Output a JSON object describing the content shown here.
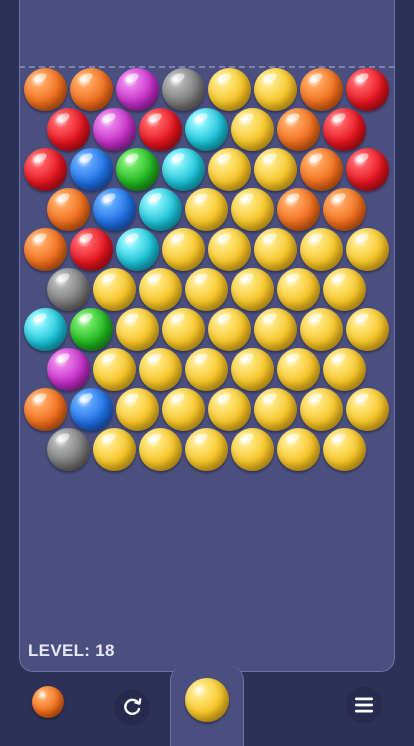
{
  "level_label": "LEVEL: 18",
  "colors": {
    "orange": {
      "base": "#ee6d1c",
      "light": "#ffa35a",
      "dark": "#b84a0a"
    },
    "red": {
      "base": "#e2141f",
      "light": "#ff5a5f",
      "dark": "#a3080f"
    },
    "magenta": {
      "base": "#c12fc4",
      "light": "#e97ae8",
      "dark": "#84138a"
    },
    "gray": {
      "base": "#7a7a7a",
      "light": "#b0b0b0",
      "dark": "#4e4e4e"
    },
    "yellow": {
      "base": "#f6c526",
      "light": "#ffe57a",
      "dark": "#d39a0c"
    },
    "blue": {
      "base": "#1e6fe0",
      "light": "#5ea6ff",
      "dark": "#0f4aa6"
    },
    "green": {
      "base": "#21b51f",
      "light": "#6ee865",
      "dark": "#0f7c12"
    },
    "cyan": {
      "base": "#1cc2d6",
      "light": "#7ef0fa",
      "dark": "#0b8ca0"
    }
  },
  "grid_rows": [
    [
      "orange",
      "orange",
      "magenta",
      "gray",
      "yellow",
      "yellow",
      "orange",
      "red"
    ],
    [
      "red",
      "magenta",
      "red",
      "cyan",
      "yellow",
      "orange",
      "red"
    ],
    [
      "red",
      "blue",
      "green",
      "cyan",
      "yellow",
      "yellow",
      "orange",
      "red"
    ],
    [
      "orange",
      "blue",
      "cyan",
      "yellow",
      "yellow",
      "orange",
      "orange"
    ],
    [
      "orange",
      "red",
      "cyan",
      "yellow",
      "yellow",
      "yellow",
      "yellow",
      "yellow"
    ],
    [
      "gray",
      "yellow",
      "yellow",
      "yellow",
      "yellow",
      "yellow",
      "yellow"
    ],
    [
      "cyan",
      "green",
      "yellow",
      "yellow",
      "yellow",
      "yellow",
      "yellow",
      "yellow"
    ],
    [
      "magenta",
      "yellow",
      "yellow",
      "yellow",
      "yellow",
      "yellow",
      "yellow"
    ],
    [
      "orange",
      "blue",
      "yellow",
      "yellow",
      "yellow",
      "yellow",
      "yellow",
      "yellow"
    ],
    [
      "gray",
      "yellow",
      "yellow",
      "yellow",
      "yellow",
      "yellow",
      "yellow"
    ]
  ],
  "next_bubble": "orange",
  "shooter_bubble": "yellow",
  "icons": {
    "swap": "refresh-icon",
    "menu": "menu-icon"
  }
}
